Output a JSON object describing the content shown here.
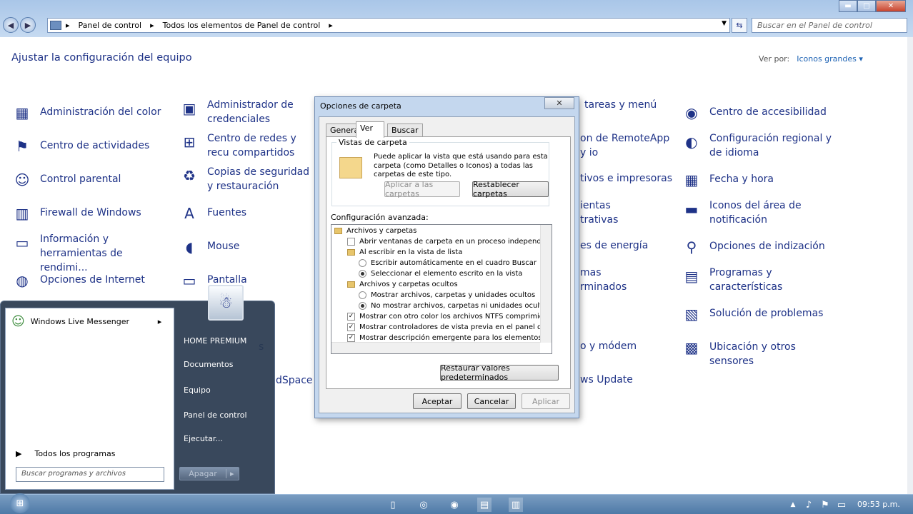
{
  "window": {
    "breadcrumb": [
      "Panel de control",
      "Todos los elementos de Panel de control"
    ],
    "search_placeholder": "Buscar en el Panel de control",
    "controls": {
      "minimize": "▬",
      "maximize": "□",
      "close": "✕"
    }
  },
  "main": {
    "heading": "Ajustar la configuración del equipo",
    "viewby_label": "Ver por:",
    "viewby_value": "Iconos grandes ▾"
  },
  "items": [
    {
      "label": "Administración del color",
      "icon": "color-icon"
    },
    {
      "label": "Centro de actividades",
      "icon": "flag-icon"
    },
    {
      "label": "Control parental",
      "icon": "parental-icon"
    },
    {
      "label": "Firewall de Windows",
      "icon": "firewall-icon"
    },
    {
      "label": "Información y herramientas de rendimi...",
      "icon": "performance-icon"
    },
    {
      "label": "Opciones de Internet",
      "icon": "internet-icon"
    },
    {
      "label": "Administrador de credenciales",
      "icon": "credentials-icon"
    },
    {
      "label": "Centro de redes y recu compartidos",
      "icon": "network-icon"
    },
    {
      "label": "Copias de seguridad y restauración",
      "icon": "backup-icon"
    },
    {
      "label": "Fuentes",
      "icon": "fonts-icon"
    },
    {
      "label": "Mouse",
      "icon": "mouse-icon"
    },
    {
      "label": "Pantalla",
      "icon": "display-icon"
    },
    {
      "label": "tareas y menú",
      "icon": ""
    },
    {
      "label": "on de RemoteApp y io",
      "icon": ""
    },
    {
      "label": "tivos e impresoras",
      "icon": ""
    },
    {
      "label": "ientas trativas",
      "icon": ""
    },
    {
      "label": "es de energía",
      "icon": ""
    },
    {
      "label": "mas rminados",
      "icon": ""
    },
    {
      "label": "o y módem",
      "icon": ""
    },
    {
      "label": "ws Update",
      "icon": ""
    },
    {
      "label": "Centro de accesibilidad",
      "icon": "accessibility-icon"
    },
    {
      "label": "Configuración regional y de idioma",
      "icon": "region-icon"
    },
    {
      "label": "Fecha y hora",
      "icon": "calendar-icon"
    },
    {
      "label": "Iconos del área de notificación",
      "icon": "tray-icon"
    },
    {
      "label": "Opciones de indización",
      "icon": "indexing-icon"
    },
    {
      "label": "Programas y características",
      "icon": "programs-icon"
    },
    {
      "label": "Solución de problemas",
      "icon": "troubleshoot-icon"
    },
    {
      "label": "Ubicación y otros sensores",
      "icon": "sensors-icon"
    },
    {
      "label": "s",
      "icon": ""
    },
    {
      "label": "dSpace",
      "icon": ""
    }
  ],
  "dialog": {
    "title": "Opciones de carpeta",
    "close": "✕",
    "tabs": [
      "General",
      "Ver",
      "Buscar"
    ],
    "group_title": "Vistas de carpeta",
    "group_text": "Puede aplicar la vista que está usando para esta carpeta (como Detalles o Iconos) a todas las carpetas de este tipo.",
    "apply_folders": "Aplicar a las carpetas",
    "reset_folders": "Restablecer carpetas",
    "advanced_label": "Configuración avanzada:",
    "rows": [
      {
        "type": "folder",
        "text": "Archivos y carpetas"
      },
      {
        "type": "check",
        "checked": false,
        "text": "Abrir ventanas de carpeta  en un proceso independiente"
      },
      {
        "type": "folder",
        "text": "Al escribir en la vista de lista"
      },
      {
        "type": "radio",
        "checked": false,
        "text": "Escribir automáticamente en el cuadro Buscar"
      },
      {
        "type": "radio",
        "checked": true,
        "text": "Seleccionar el elemento escrito en la vista"
      },
      {
        "type": "folder",
        "text": "Archivos y carpetas ocultos"
      },
      {
        "type": "radio",
        "checked": false,
        "text": "Mostrar archivos, carpetas y unidades ocultos"
      },
      {
        "type": "radio",
        "checked": true,
        "text": "No mostrar archivos, carpetas ni unidades ocultos"
      },
      {
        "type": "check",
        "checked": true,
        "text": "Mostrar con otro color los archivos NTFS comprimidos o c"
      },
      {
        "type": "check",
        "checked": true,
        "text": "Mostrar controladores de vista previa en el panel de vista"
      },
      {
        "type": "check",
        "checked": true,
        "text": "Mostrar descripción emergente para los elementos de car"
      }
    ],
    "restore_defaults": "Restaurar valores predeterminados",
    "ok": "Aceptar",
    "cancel": "Cancelar",
    "apply": "Aplicar"
  },
  "start_menu": {
    "pinned": "Windows Live Messenger",
    "all_programs": "Todos los programas",
    "search_placeholder": "Buscar programas y archivos",
    "right": [
      "HOME PREMIUM",
      "Documentos",
      "Equipo",
      "Panel de control",
      "Ejecutar..."
    ],
    "shutdown": "Apagar"
  },
  "taskbar": {
    "clock": "09:53 p.m."
  }
}
